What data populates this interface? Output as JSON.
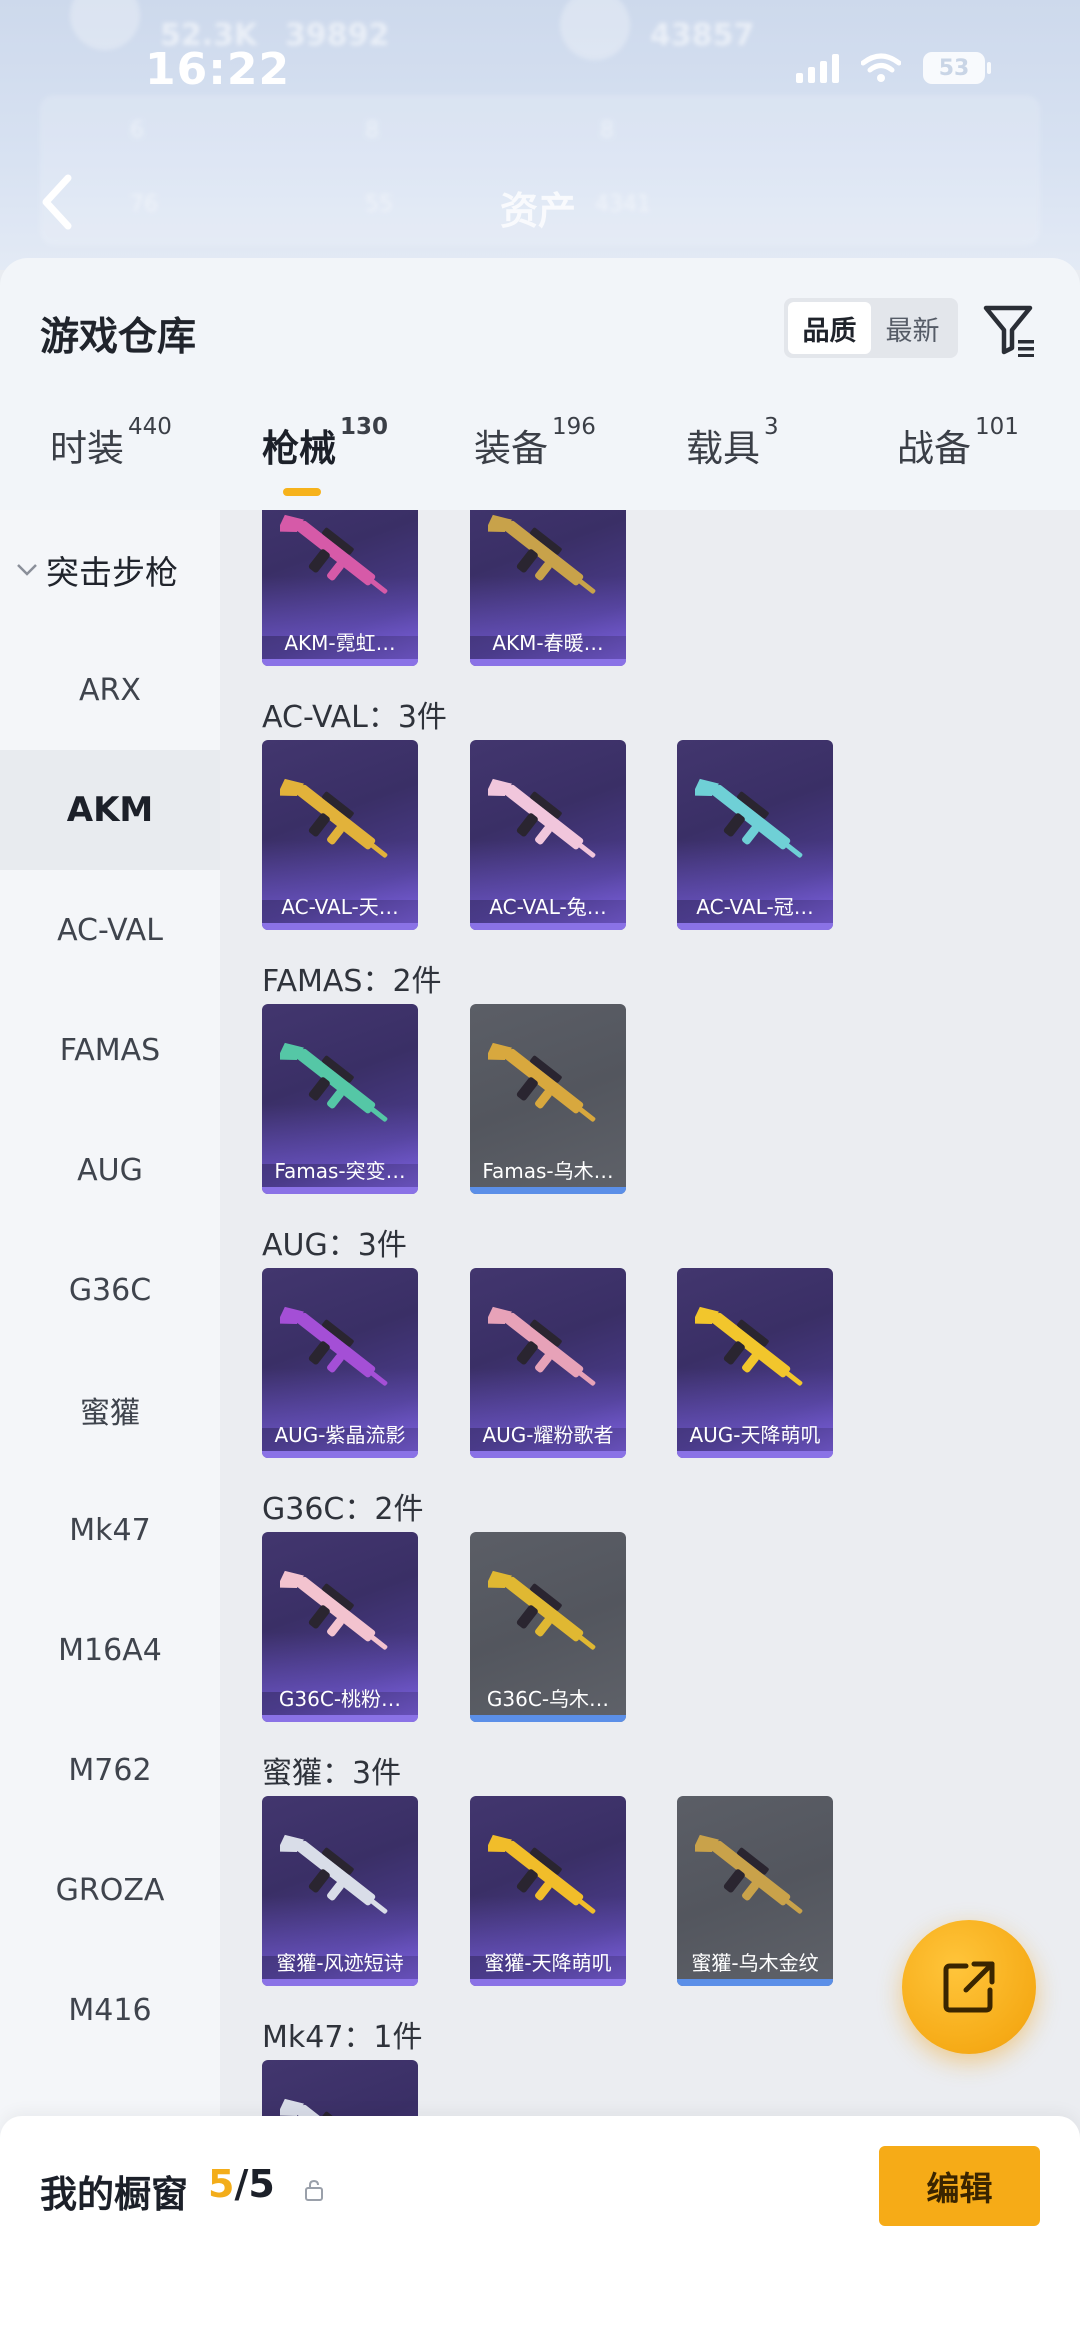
{
  "status_bar": {
    "time": "16:22",
    "battery": "53"
  },
  "header_bg": {
    "title": "资产",
    "numbers": [
      "52.3K",
      "39892",
      "43857"
    ],
    "stats_row1": [
      "6",
      "8",
      "8"
    ],
    "stats_row2": [
      "76",
      "55",
      "4341"
    ]
  },
  "sheet": {
    "title": "游戏仓库",
    "sort_options": [
      {
        "label": "品质",
        "active": true
      },
      {
        "label": "最新",
        "active": false
      }
    ]
  },
  "tabs": [
    {
      "label": "时装",
      "count": "440"
    },
    {
      "label": "枪械",
      "count": "130",
      "active": true
    },
    {
      "label": "装备",
      "count": "196"
    },
    {
      "label": "载具",
      "count": "3"
    },
    {
      "label": "战备",
      "count": "101"
    }
  ],
  "sidebar": {
    "group": "突击步枪",
    "items": [
      "ARX",
      "AKM",
      "AC-VAL",
      "FAMAS",
      "AUG",
      "G36C",
      "蜜獾",
      "Mk47",
      "M16A4",
      "M762",
      "GROZA",
      "M416"
    ],
    "active": "AKM"
  },
  "sections": [
    {
      "title": "",
      "items": [
        {
          "label": "AKM-霓虹…",
          "rarity": "purple",
          "color": "#d65aa8"
        },
        {
          "label": "AKM-春暖…",
          "rarity": "purple",
          "color": "#c8a24a"
        }
      ]
    },
    {
      "title": "AC-VAL：3件",
      "items": [
        {
          "label": "AC-VAL-天…",
          "rarity": "purple",
          "color": "#e2b23a"
        },
        {
          "label": "AC-VAL-兔…",
          "rarity": "purple",
          "color": "#f1c6dc"
        },
        {
          "label": "AC-VAL-冠…",
          "rarity": "purple",
          "color": "#6fd0d6"
        }
      ]
    },
    {
      "title": "FAMAS：2件",
      "items": [
        {
          "label": "Famas-突变…",
          "rarity": "purple",
          "color": "#55c7a6"
        },
        {
          "label": "Famas-乌木…",
          "rarity": "grey",
          "color": "#d8a83e"
        }
      ]
    },
    {
      "title": "AUG：3件",
      "items": [
        {
          "label": "AUG-紫晶流影",
          "rarity": "purple",
          "color": "#a44fd6"
        },
        {
          "label": "AUG-耀粉歌者",
          "rarity": "purple",
          "color": "#e7a2b8"
        },
        {
          "label": "AUG-天降萌叽",
          "rarity": "purple",
          "color": "#f2c62c"
        }
      ]
    },
    {
      "title": "G36C：2件",
      "items": [
        {
          "label": "G36C-桃粉…",
          "rarity": "purple",
          "color": "#f3c3cf"
        },
        {
          "label": "G36C-乌木…",
          "rarity": "grey",
          "color": "#e0b832"
        }
      ]
    },
    {
      "title": "蜜獾：3件",
      "items": [
        {
          "label": "蜜獾-风迹短诗",
          "rarity": "purple",
          "color": "#d9dde8"
        },
        {
          "label": "蜜獾-天降萌叽",
          "rarity": "purple",
          "color": "#f1bd2a"
        },
        {
          "label": "蜜獾-乌木金纹",
          "rarity": "grey",
          "color": "#c9a24a"
        }
      ]
    },
    {
      "title": "Mk47：1件",
      "items": [
        {
          "label": "",
          "rarity": "purple",
          "color": "#d9dde8"
        }
      ]
    }
  ],
  "showcase": {
    "label": "我的橱窗",
    "current": "5",
    "separator": "/",
    "max": "5"
  },
  "edit_label": "编辑",
  "colors": {
    "accent": "#f6ab17",
    "purple_card": "#3a2f66",
    "grey_card": "#55585f"
  }
}
